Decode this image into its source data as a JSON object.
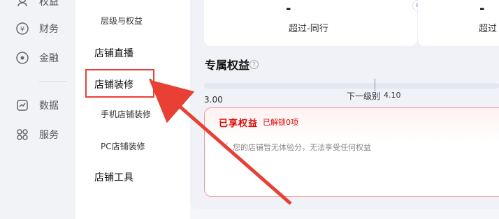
{
  "left_nav": {
    "items": [
      {
        "label": "权益",
        "icon": "badge-icon"
      },
      {
        "label": "财务",
        "icon": "yen-icon"
      },
      {
        "label": "金融",
        "icon": "finance-icon"
      },
      {
        "label": "数据",
        "icon": "chart-icon"
      },
      {
        "label": "服务",
        "icon": "grid-icon"
      }
    ]
  },
  "sub_nav": {
    "items": [
      {
        "label": "层级与权益",
        "type": "child"
      },
      {
        "label": "店铺直播",
        "type": "section"
      },
      {
        "label": "店铺装修",
        "type": "section",
        "expanded": true
      },
      {
        "label": "手机店铺装修",
        "type": "child"
      },
      {
        "label": "PC店铺装修",
        "type": "child"
      },
      {
        "label": "店铺工具",
        "type": "section"
      }
    ]
  },
  "stats": {
    "a": {
      "value": "-",
      "label": "超过-同行"
    },
    "b": {
      "value": "-",
      "label": "超过"
    }
  },
  "mini_badge": "≡",
  "exclusive": {
    "title": "专属权益",
    "help_icon": "?",
    "score": "3.00",
    "next_level_label": "下一级别",
    "next_level_value": "4.10"
  },
  "benefits": {
    "title": "已享权益",
    "unlocked_text": "已解锁0项",
    "check_icon": "✓",
    "note": "您的店铺暂无体验分，无法享受任何权益"
  },
  "colors": {
    "accent_red": "#e10600",
    "highlight_red": "#e84035"
  }
}
